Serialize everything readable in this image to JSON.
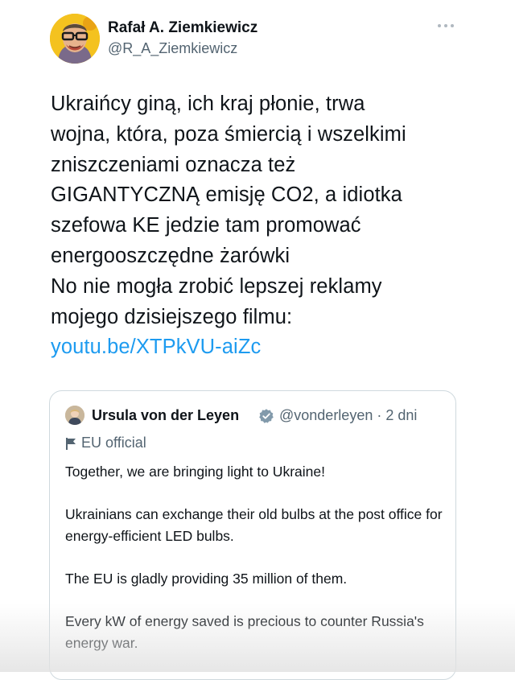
{
  "author": {
    "name": "Rafał A. Ziemkiewicz",
    "handle": "@R_A_Ziemkiewicz",
    "avatar_icon": "user-avatar-caricature"
  },
  "more_icon": "more-horizontal-icon",
  "tweet": {
    "lines": [
      "Ukraińcy giną, ich kraj płonie, trwa",
      "wojna, która, poza śmiercią i wszelkimi",
      "zniszczeniami oznacza też",
      "GIGANTYCZNĄ emisję CO2, a idiotka",
      "szefowa KE jedzie tam promować",
      "energooszczędne żarówki",
      "No nie mogła zrobić lepszej reklamy",
      "mojego dzisiejszego filmu:"
    ],
    "link": "youtu.be/XTPkVU-aiZc"
  },
  "quote": {
    "name": "Ursula von der Leyen",
    "handle_time": "@vonderleyen · 2 dni",
    "label": "EU official",
    "verified_icon": "verified-badge-icon",
    "label_icon": "flag-icon",
    "paragraphs": [
      "Together, we are bringing light to Ukraine!",
      "Ukrainians can exchange their old bulbs at the post office for energy-efficient LED bulbs.",
      "The EU is gladly providing 35 million of them.",
      "Every kW of energy saved is precious to counter Russia's energy war."
    ]
  },
  "colors": {
    "text": "#0f1419",
    "secondary": "#536471",
    "link": "#1d9bf0",
    "border": "#cfd9de",
    "verified": "#829aab"
  }
}
